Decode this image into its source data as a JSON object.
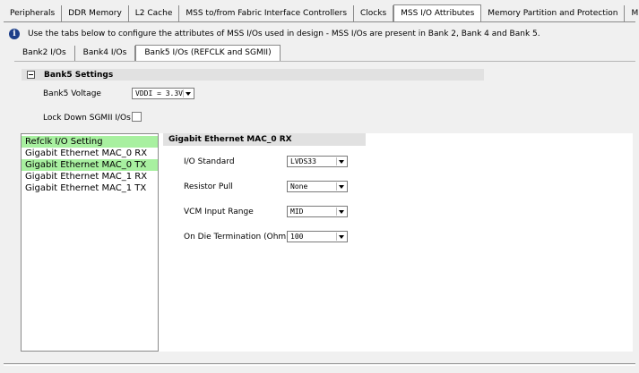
{
  "tabs": [
    "Peripherals",
    "DDR Memory",
    "L2 Cache",
    "MSS to/from Fabric Interface Controllers",
    "Clocks",
    "MSS I/O Attributes",
    "Memory Partition and Protection",
    "Misc"
  ],
  "active_tab_index": 5,
  "info": {
    "icon": "info-icon",
    "text": "Use the tabs below to configure the attributes of MSS I/Os used in design - MSS I/Os are present in Bank 2, Bank 4 and Bank 5."
  },
  "subtabs": [
    "Bank2 I/Os",
    "Bank4 I/Os",
    "Bank5 I/Os (REFCLK and SGMII)"
  ],
  "active_subtab_index": 2,
  "bank5": {
    "section_title": "Bank5 Settings",
    "voltage_label": "Bank5 Voltage",
    "voltage_value": "VDDI = 3.3V",
    "lockdown_label": "Lock Down SGMII I/Os",
    "lockdown_checked": false
  },
  "io_list": {
    "items": [
      {
        "label": "Refclk I/O Setting",
        "highlight": true
      },
      {
        "label": "Gigabit Ethernet MAC_0 RX",
        "highlight": false
      },
      {
        "label": "Gigabit Ethernet MAC_0 TX",
        "highlight": true
      },
      {
        "label": "Gigabit Ethernet MAC_1 RX",
        "highlight": false
      },
      {
        "label": "Gigabit Ethernet MAC_1 TX",
        "highlight": false
      }
    ],
    "highlight_color": "#a8f0a0"
  },
  "detail": {
    "title": "Gigabit Ethernet MAC_0 RX",
    "fields": [
      {
        "label": "I/O Standard",
        "value": "LVDS33"
      },
      {
        "label": "Resistor Pull",
        "value": "None"
      },
      {
        "label": "VCM Input Range",
        "value": "MID"
      },
      {
        "label": "On Die Termination (Ohm)",
        "value": "100"
      }
    ]
  }
}
